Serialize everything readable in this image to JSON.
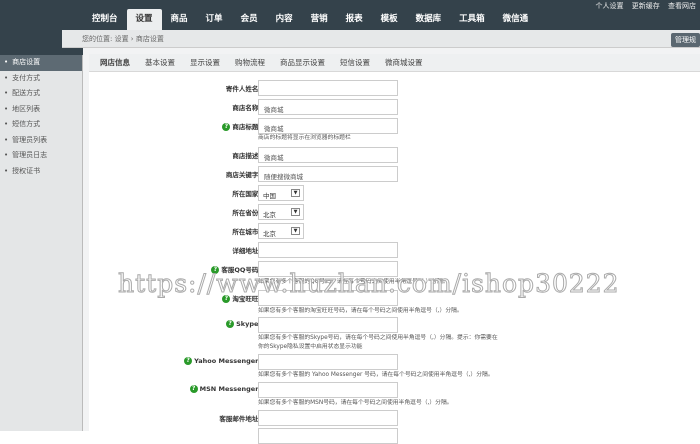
{
  "top_links": [
    "个人设置",
    "更新缓存",
    "查看网店"
  ],
  "nav": [
    "控制台",
    "设置",
    "商品",
    "订单",
    "会员",
    "内容",
    "营销",
    "报表",
    "模板",
    "数据库",
    "工具箱",
    "微信通"
  ],
  "breadcrumb": "您的位置: 设置 › 商店设置",
  "manage_button": "管理规",
  "sidebar": [
    "商店设置",
    "支付方式",
    "配送方式",
    "地区列表",
    "短信方式",
    "管理员列表",
    "管理员日志",
    "授权证书"
  ],
  "tabs": [
    "网店信息",
    "基本设置",
    "显示设置",
    "购物流程",
    "商品显示设置",
    "短信设置",
    "微商城设置"
  ],
  "form": {
    "sender": {
      "label": "寄件人姓名:",
      "value": ""
    },
    "shop_name": {
      "label": "商店名称:",
      "value": "微商城"
    },
    "shop_title": {
      "label": "商店标题:",
      "value": "微商城",
      "hint": "商店的标题将显示在浏览器的标题栏"
    },
    "shop_desc": {
      "label": "商店描述:",
      "value": "微商城"
    },
    "keywords": {
      "label": "商店关键字:",
      "value": "随便搜微商城"
    },
    "country": {
      "label": "所在国家:",
      "value": "中国"
    },
    "province": {
      "label": "所在省份:",
      "value": "北京"
    },
    "city": {
      "label": "所在城市:",
      "value": "北京"
    },
    "address": {
      "label": "详细地址:",
      "value": ""
    },
    "qq": {
      "label": "客服QQ号码:",
      "value": "",
      "hint": "如果您有多个客服的QQ号码，请在每个号码之间使用半角逗号（,）分隔。"
    },
    "wangwang": {
      "label": "淘宝旺旺:",
      "value": "",
      "hint": "如果您有多个客服的淘宝旺旺号码，请在每个号码之间使用半角逗号（,）分隔。"
    },
    "skype": {
      "label": "Skype:",
      "value": "",
      "hint": "如果您有多个客服的Skype号码，请在每个号码之间使用半角逗号（,）分隔。提示：你需要在你的Skype隐私设置中启用状态显示功能"
    },
    "yahoo": {
      "label": "Yahoo Messenger:",
      "value": "",
      "hint": "如果您有多个客服的 Yahoo Messenger 号码，请在每个号码之间使用半角逗号（,）分隔。"
    },
    "msn": {
      "label": "MSN Messenger:",
      "value": "",
      "hint": "如果您有多个客服的MSN号码，请在每个号码之间使用半角逗号（,）分隔。"
    },
    "email": {
      "label": "客服邮件地址:",
      "value": ""
    }
  },
  "watermark": "https://www.huzhan.com/ishop30222"
}
